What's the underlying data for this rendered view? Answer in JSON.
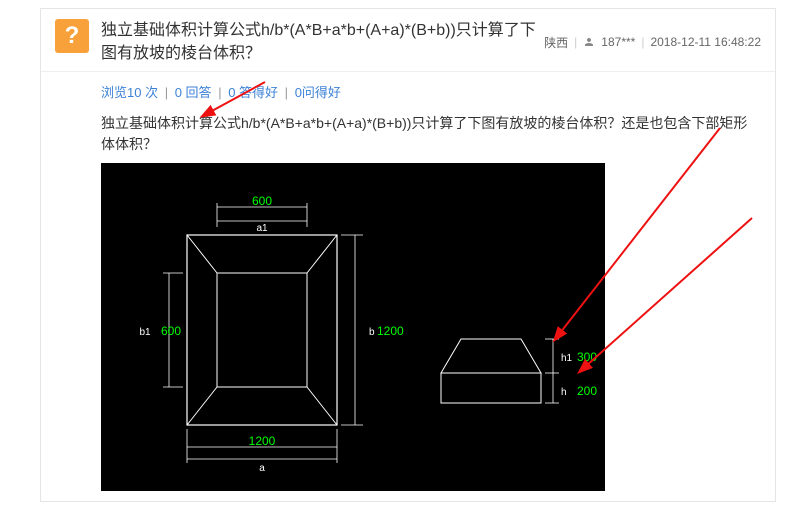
{
  "header": {
    "question_mark": "?",
    "title": "独立基础体积计算公式h/b*(A*B+a*b+(A+a)*(B+b))只计算了下图有放坡的棱台体积？",
    "province": "陕西",
    "user": "187***",
    "datetime": "2018-12-11 16:48:22"
  },
  "stats": {
    "views": "浏览10 次",
    "answers": "0 回答",
    "good_answers": "0 答得好",
    "good_questions": "0问得好"
  },
  "body": {
    "text": "独立基础体积计算公式h/b*(A*B+a*b+(A+a)*(B+b))只计算了下图有放坡的棱台体积？还是也包含下部矩形体体积？"
  },
  "diagram": {
    "top_dim": "600",
    "top_label": "a1",
    "bottom_dim": "1200",
    "bottom_label": "a",
    "left_dim": "600",
    "left_label": "b1",
    "right_dim": "1200",
    "right_label": "b",
    "side_h1_label": "h1",
    "side_h1_val": "300",
    "side_h_label": "h",
    "side_h_val": "200"
  }
}
